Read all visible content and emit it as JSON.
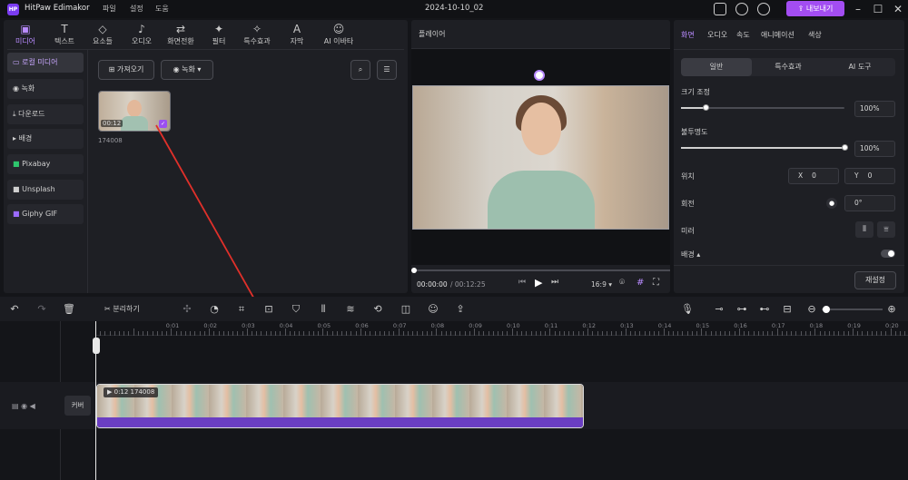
{
  "app": {
    "name": "HitPaw Edimakor",
    "logo": "HP",
    "menus": [
      "파일",
      "설정",
      "도움"
    ],
    "doc_title": "2024-10-10_02",
    "export_label": "내보내기"
  },
  "toolbar": [
    "미디어",
    "텍스트",
    "요소들",
    "오디오",
    "화면전환",
    "필터",
    "특수효과",
    "자막",
    "AI 이바타"
  ],
  "sidebar": [
    "로컬 미디어",
    "녹화",
    "다운로드",
    "배경",
    "Pixabay",
    "Unsplash",
    "Giphy GIF"
  ],
  "media": {
    "import_label": "가져오기",
    "record_label": "녹화",
    "clip_duration": "00:12",
    "clip_name": "174008"
  },
  "player": {
    "title": "플레이어",
    "current_time": "00:00:00",
    "total_time": "/ 00:12:25",
    "ratio": "16:9"
  },
  "properties": {
    "tabs": [
      "화면",
      "오디오",
      "속도",
      "애니메이션",
      "색상"
    ],
    "segments": [
      "일반",
      "특수효과",
      "AI 도구"
    ],
    "scale_label": "크기 조정",
    "scale_value": "100%",
    "scale_level": 0.15,
    "opacity_label": "불투명도",
    "opacity_value": "100%",
    "opacity_level": 1.0,
    "position_label": "위치",
    "x_label": "X",
    "x_value": "0",
    "y_label": "Y",
    "y_value": "0",
    "rotation_label": "회전",
    "rotation_value": "0°",
    "mirror_label": "미러",
    "background_label": "배경",
    "reset_label": "재설정"
  },
  "timeline": {
    "split_label": "분리하기",
    "ticks": [
      "0:00",
      "0:01",
      "0:02",
      "0:03",
      "0:04",
      "0:05",
      "0:06",
      "0:07",
      "0:08",
      "0:09",
      "0:10",
      "0:11",
      "0:12",
      "0:13",
      "0:14",
      "0:15",
      "0:16",
      "0:17",
      "0:18",
      "0:19",
      "0:20",
      "0:21"
    ],
    "cover_label": "커버",
    "clip_label": "0:12 174008"
  }
}
